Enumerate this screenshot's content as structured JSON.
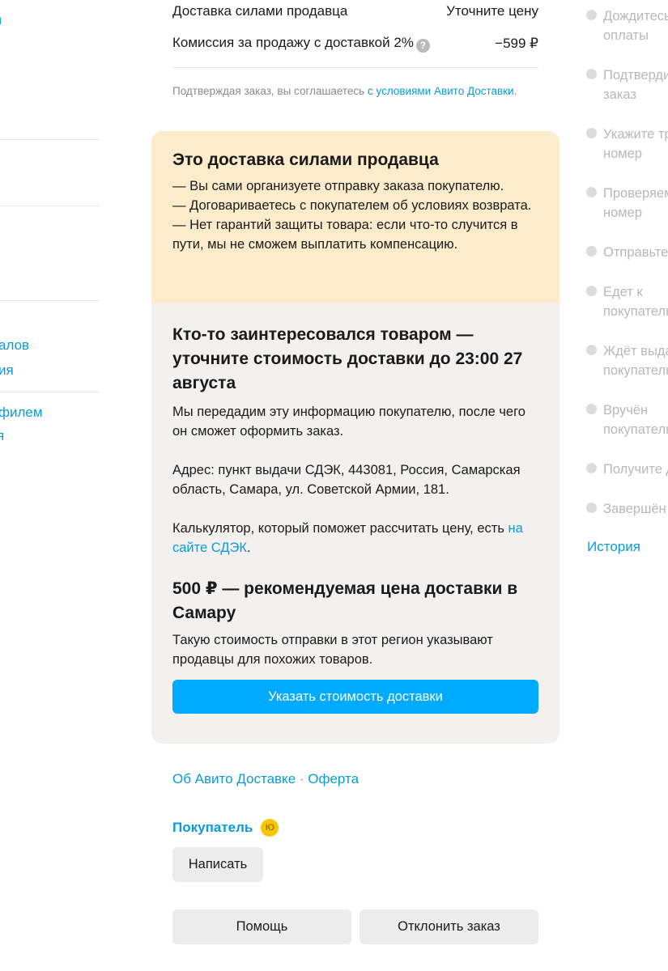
{
  "sidebar": {
    "links": [
      "алов",
      "ия",
      "филем",
      "я"
    ]
  },
  "summary": {
    "delivery_label": "Доставка силами продавца",
    "delivery_value": "Уточните цену",
    "commission_label": "Комиссия за продажу с доставкой 2%",
    "commission_value": "−599 ₽",
    "help_glyph": "?",
    "terms_text": "Подтверждая заказ, вы соглашаетесь ",
    "terms_link": "с условиями Авито Доставки",
    "terms_end": "."
  },
  "warning": {
    "title": "Это доставка силами продавца",
    "line1": "— Вы сами организуете отправку заказа покупателю.",
    "line2": "— Договариваетесь с покупателем об условиях возврата.",
    "line3": "— Нет гарантий защиты товара: если что-то случится в пути, мы не сможем выплатить компенсацию."
  },
  "request": {
    "title": "Кто-то заинтересовался товаром — уточните стоимость доставки до 23:00 27 августа",
    "info": "Мы передадим эту информацию покупателю, после чего он сможет оформить заказ.",
    "address": "Адрес: пункт выдачи СДЭК, 443081, Россия, Самарская область, Самара, ул. Советской Армии, 181.",
    "calc_text": "Калькулятор, который поможет рассчитать цену, есть ",
    "calc_link": "на сайте СДЭК",
    "calc_end": ".",
    "recommend_title": "500 ₽ — рекомендуемая цена доставки в Самару",
    "recommend_text": "Такую стоимость отправки в этот регион указывают продавцы для похожих товаров.",
    "button": "Указать стоимость доставки"
  },
  "footer_links": {
    "about": "Об Авито Доставке",
    "separator": " · ",
    "offer": "Оферта"
  },
  "buyer": {
    "label": "Покупатель",
    "avatar_letter": "Ю",
    "write_button": "Написать"
  },
  "actions": {
    "help": "Помощь",
    "decline": "Отклонить заказ"
  },
  "steps": [
    "Дождитесь\nоплаты",
    "Подтвердите\nзаказ",
    "Укажите трек-\nномер",
    "Проверяем\nномер",
    "Отправьте",
    "Едет к\nпокупателю",
    "Ждёт выдачи\nпокупателю",
    "Вручён\nпокупателю",
    "Получите деньги",
    "Завершён"
  ],
  "history_link": "История",
  "colors": {
    "accent": "#00aaff",
    "link": "#0a9bd8",
    "warning_bg": "#fdeccb",
    "card_bg": "#f2f1f0"
  }
}
